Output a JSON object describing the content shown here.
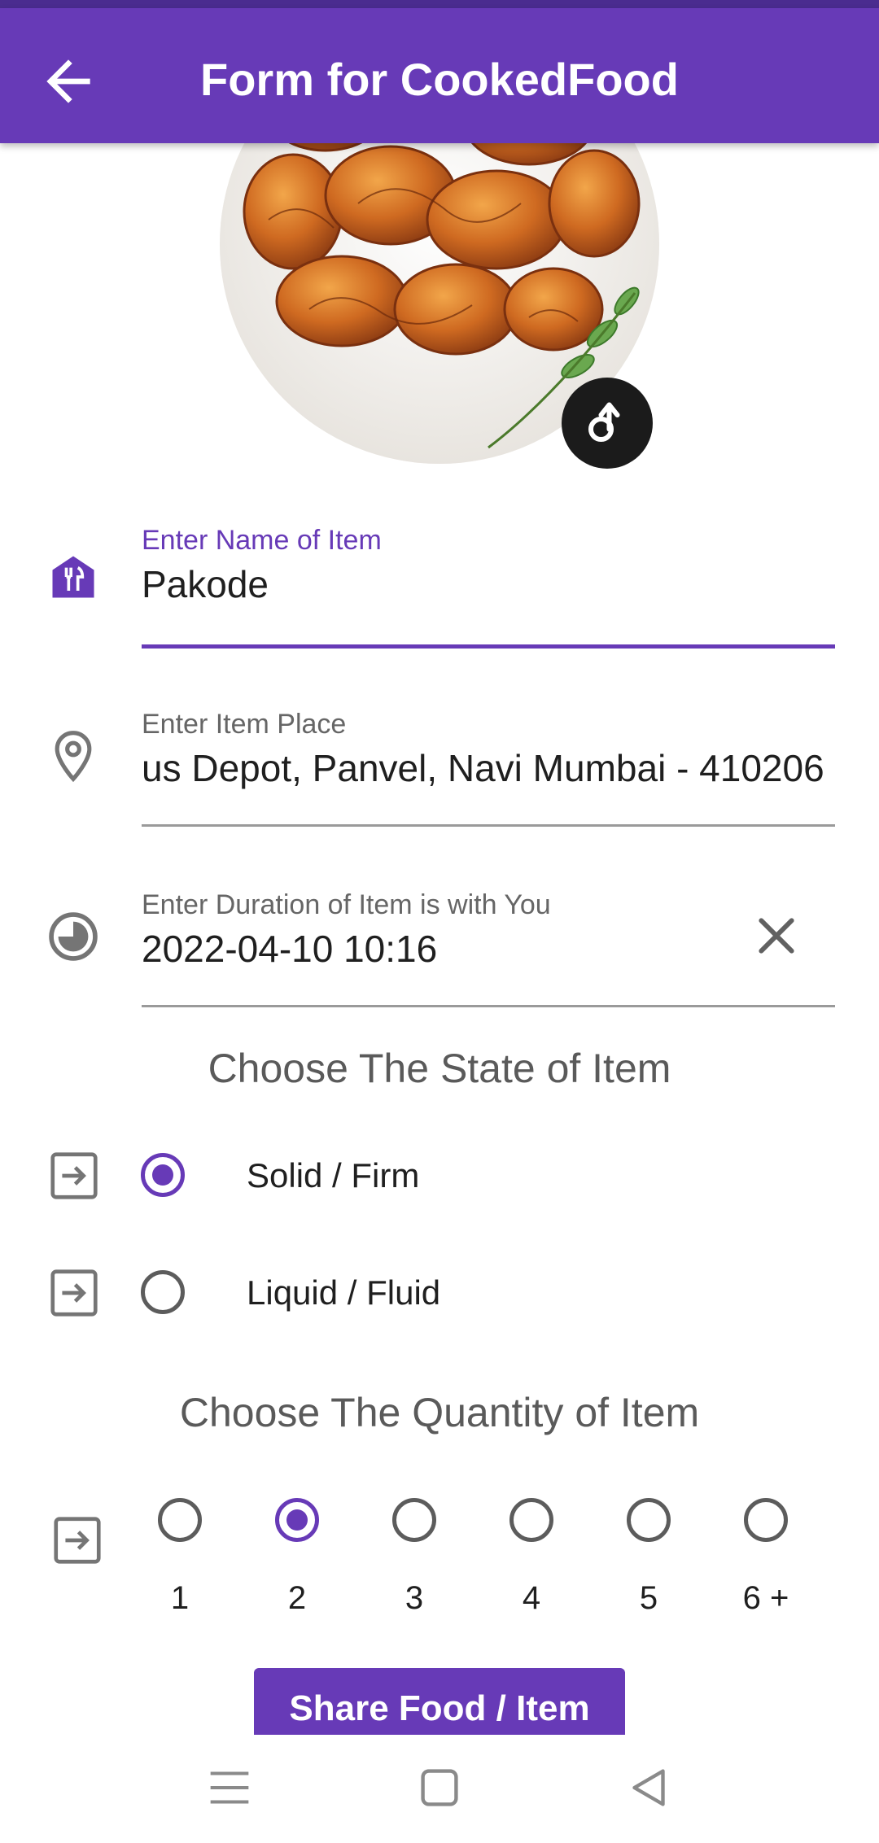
{
  "app": {
    "title": "Form for CookedFood"
  },
  "icons": {
    "back": "arrow-left-icon",
    "upload": "upload-arrow-icon",
    "name_field": "restaurant-storefront-icon",
    "place_field": "location-pin-icon",
    "duration_field": "clock-icon",
    "clear": "close-icon",
    "row": "input-arrow-icon",
    "nav_menu": "menu-lines-icon",
    "nav_home": "square-home-icon",
    "nav_back": "triangle-back-icon"
  },
  "colors": {
    "primary": "#673ab7",
    "status_bar": "#4a2c8f",
    "upload_button": "#1b1b1b"
  },
  "form": {
    "name": {
      "label": "Enter Name of Item",
      "value": "Pakode"
    },
    "place": {
      "label": "Enter Item Place",
      "value": "us Depot, Panvel, Navi Mumbai - 410206"
    },
    "duration": {
      "label": "Enter Duration of Item is with You",
      "value": "2022-04-10 10:16"
    }
  },
  "state_section": {
    "title": "Choose The State of Item",
    "options": [
      {
        "label": "Solid / Firm",
        "selected": true
      },
      {
        "label": "Liquid / Fluid",
        "selected": false
      }
    ]
  },
  "quantity_section": {
    "title": "Choose The Quantity of Item",
    "options": [
      {
        "label": "1",
        "selected": false
      },
      {
        "label": "2",
        "selected": true
      },
      {
        "label": "3",
        "selected": false
      },
      {
        "label": "4",
        "selected": false
      },
      {
        "label": "5",
        "selected": false
      },
      {
        "label": "6 +",
        "selected": false
      }
    ]
  },
  "share_button": {
    "label": "Share Food / Item"
  }
}
